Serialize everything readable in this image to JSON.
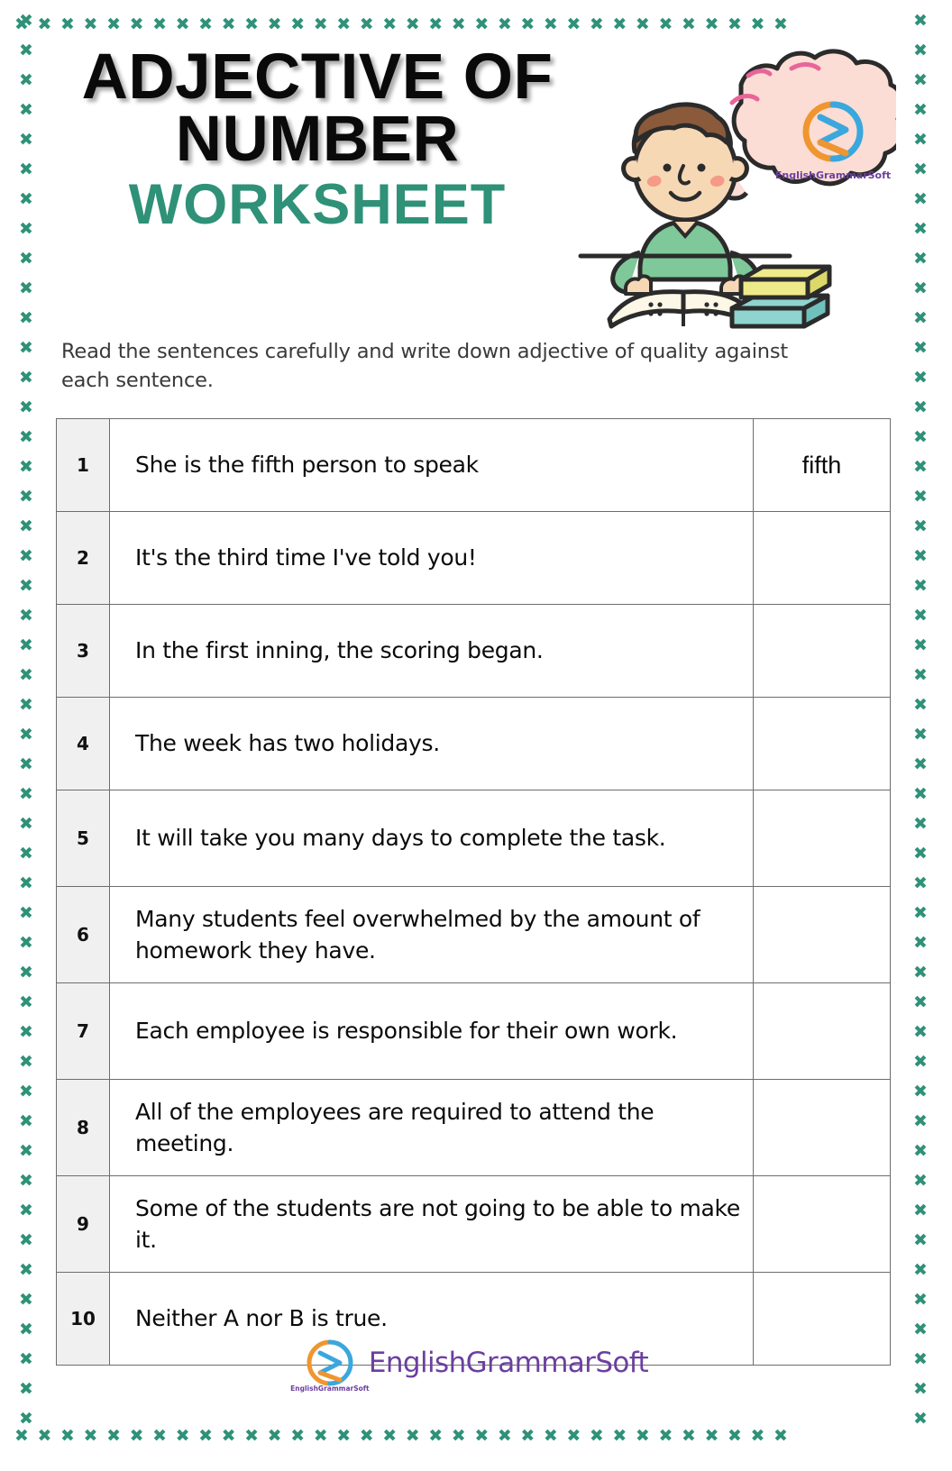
{
  "page": {
    "title_line1": "ADJECTIVE OF",
    "title_line2": "NUMBER",
    "title_sub": "WORKSHEET",
    "instructions": "Read the sentences carefully and write down adjective of quality against each sentence.",
    "border_glyph": "✖",
    "colors": {
      "accent_teal": "#2f9178",
      "border_teal": "#2f9178",
      "number_cell_bg": "#f0f0f0",
      "table_border": "#6d6d6d",
      "logo_purple": "#6b3fa0",
      "logo_orange": "#f0952f",
      "logo_blue": "#3aa7dd",
      "bubble_pink": "#fbddd5",
      "skin": "#f7d8b5",
      "hair_brown": "#8a5a3b",
      "shirt_green": "#7ec89a",
      "book_yellow": "#eeea8a",
      "book_teal": "#8fd4cf",
      "blush_pink": "#f58f7f",
      "outline_dark": "#2b2b2b"
    }
  },
  "illustration": {
    "bubble_logo_caption": "EnglishGrammarSoft"
  },
  "table": {
    "rows": [
      {
        "num": "1",
        "sentence": "She is the fifth person to speak",
        "answer": "fifth",
        "tall": false
      },
      {
        "num": "2",
        "sentence": "It's the third time I've told you!",
        "answer": "",
        "tall": false
      },
      {
        "num": "3",
        "sentence": "In the first inning, the scoring began.",
        "answer": "",
        "tall": false
      },
      {
        "num": "4",
        "sentence": "The week has two holidays.",
        "answer": "",
        "tall": false
      },
      {
        "num": "5",
        "sentence": "It will take you many days to complete the task.",
        "answer": "",
        "tall": true
      },
      {
        "num": "6",
        "sentence": "Many students feel overwhelmed by the amount of homework they have.",
        "answer": "",
        "tall": true
      },
      {
        "num": "7",
        "sentence": "Each employee is responsible for their own work.",
        "answer": "",
        "tall": true
      },
      {
        "num": "8",
        "sentence": "All of the employees are required to attend the meeting.",
        "answer": "",
        "tall": true
      },
      {
        "num": "9",
        "sentence": "Some of the students are not going to be able to make it.",
        "answer": "",
        "tall": true
      },
      {
        "num": "10",
        "sentence": "Neither A nor B is true.",
        "answer": "",
        "tall": false
      }
    ]
  },
  "footer": {
    "wordmark": "EnglishGrammarSoft",
    "logo_caption": "EnglishGrammarSoft"
  }
}
